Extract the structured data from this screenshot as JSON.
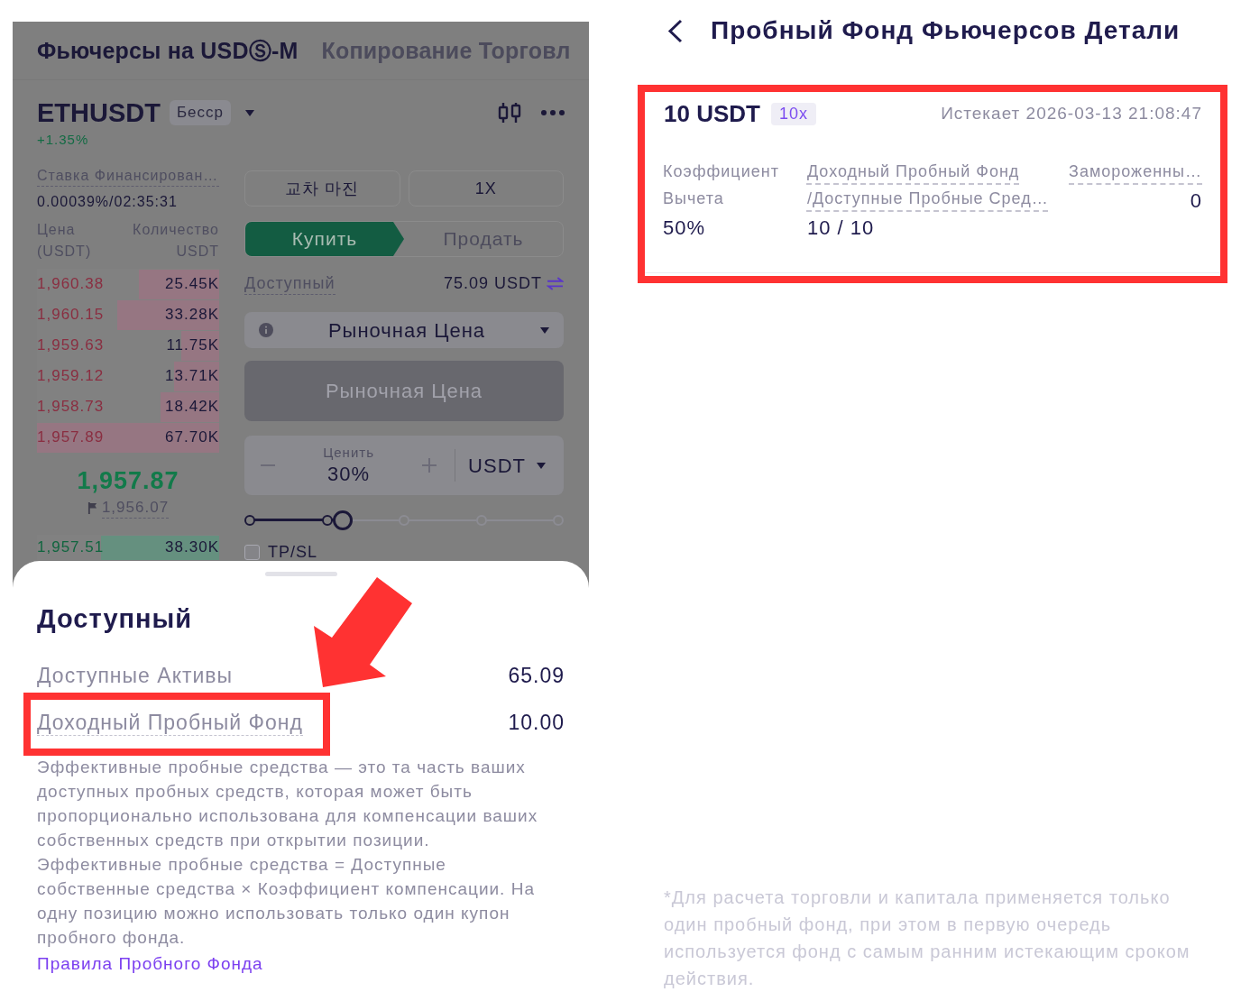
{
  "futures": {
    "tabs": [
      {
        "label": "Фьючерсы на USDⓈ-M",
        "selected": true
      },
      {
        "label": "Копирование Торговл",
        "selected": false
      }
    ],
    "symbol": "ETHUSDT",
    "contract_badge": "Бесср",
    "change": "+1.35%",
    "funding": {
      "label": "Ставка Финансирован…",
      "value": "0.00039%/02:35:31"
    },
    "order_book": {
      "price_header": "Цена (USDT)",
      "amount_header": "Количество USDT",
      "asks": [
        {
          "price": "1,960.38",
          "amount": "25.45K",
          "level": 0.44
        },
        {
          "price": "1,960.15",
          "amount": "33.28K",
          "level": 0.56
        },
        {
          "price": "1,959.63",
          "amount": "11.75K",
          "level": 0.21
        },
        {
          "price": "1,959.12",
          "amount": "13.71K",
          "level": 0.25
        },
        {
          "price": "1,958.73",
          "amount": "18.42K",
          "level": 0.32
        },
        {
          "price": "1,957.89",
          "amount": "67.70K",
          "level": 1
        }
      ],
      "last_price": "1,957.87",
      "mark_price": "1,956.07",
      "bids": [
        {
          "price": "1,957.51",
          "amount": "38.30K",
          "level": 0.65
        }
      ]
    },
    "margin_buttons": [
      {
        "label": "교차 마진"
      },
      {
        "label": "1X"
      }
    ],
    "sides": [
      {
        "label": "Купить",
        "selected": true
      },
      {
        "label": "Продать",
        "selected": false
      }
    ],
    "available": {
      "label": "Доступный",
      "value": "75.09 USDT"
    },
    "order_type": "Рыночная Цена",
    "price_field": {
      "placeholder": "Рыночная Цена",
      "disabled": true
    },
    "amount_field": {
      "label": "Ценить",
      "value": "30%",
      "unit": "USDT"
    },
    "slider": {
      "level": 0.3
    },
    "tpsl": {
      "label": "TP/SL",
      "checked": false
    }
  },
  "sheet": {
    "title": "Доступный",
    "rows": [
      {
        "label": "Доступные Активы",
        "value": "65.09",
        "underlined": false,
        "highlighted": false
      },
      {
        "label": "Доходный Пробный Фонд",
        "value": "10.00",
        "underlined": true,
        "highlighted": true
      }
    ],
    "note": "Эффективные пробные средства — это та часть ваших доступных пробных средств, которая может быть пропорционально использована для компенсации ваших собственных средств при открытии позиции. Эффективные пробные средства = Доступные собственные средства × Коэффициент компенсации. На одну позицию можно использовать только один купон пробного фонда.",
    "link": "Правила Пробного Фонда"
  },
  "details": {
    "title": "Пробный Фонд Фьючерсов Детали",
    "card": {
      "highlighted": true,
      "amount": "10 USDT",
      "multiplier": "10x",
      "expiry": "Истекает 2026-03-13 21:08:47",
      "fields": [
        {
          "label_lines": [
            "Коэффициент Вычета"
          ],
          "value": "50%",
          "underlined": false
        },
        {
          "label_lines": [
            "Доходный Пробный Фонд",
            "/Доступные Пробные Сред…"
          ],
          "value": "10 / 10",
          "underlined": true
        },
        {
          "label_lines": [
            "Замороженны…"
          ],
          "value": "0",
          "underlined": true
        }
      ]
    },
    "footnote": "*Для расчета торговли и капитала применяется только один пробный фонд, при этом в первую очередь используется фонд с самым ранним истекающим сроком действия."
  }
}
